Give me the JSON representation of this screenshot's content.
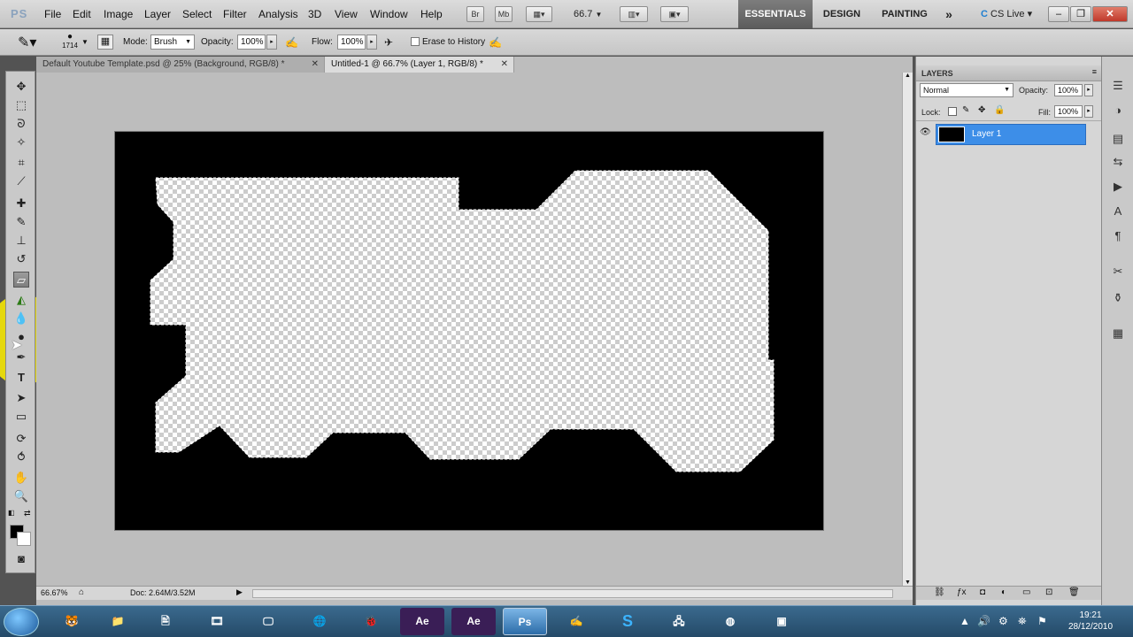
{
  "app": {
    "logo": "PS"
  },
  "menu": [
    "File",
    "Edit",
    "Image",
    "Layer",
    "Select",
    "Filter",
    "Analysis",
    "3D",
    "View",
    "Window",
    "Help"
  ],
  "appbar": {
    "bridge": "Br",
    "minibridge": "Mb",
    "zoom": "66.7",
    "zoom_arrow": "▼"
  },
  "workspaces": {
    "essentials": "ESSENTIALS",
    "design": "DESIGN",
    "painting": "PAINTING",
    "more": "»"
  },
  "cslive": "CS Live",
  "window_controls": {
    "minimize": "–",
    "restore": "❐",
    "close": "✕"
  },
  "options": {
    "brush_size": "1714",
    "mode_label": "Mode:",
    "mode_value": "Brush",
    "opacity_label": "Opacity:",
    "opacity_value": "100%",
    "flow_label": "Flow:",
    "flow_value": "100%",
    "erase_history": "Erase to History"
  },
  "tabs": [
    {
      "label": "Default Youtube Template.psd @ 25% (Background, RGB/8) *",
      "close": "✕"
    },
    {
      "label": "Untitled-1 @ 66.7% (Layer 1, RGB/8) *",
      "close": "✕"
    }
  ],
  "status": {
    "zoom": "66.67%",
    "doc": "Doc: 2.64M/3.52M"
  },
  "layers_panel": {
    "title": "LAYERS",
    "blend_mode": "Normal",
    "opacity_label": "Opacity:",
    "opacity_value": "100%",
    "lock_label": "Lock:",
    "fill_label": "Fill:",
    "fill_value": "100%",
    "layers": [
      {
        "name": "Layer 1",
        "visible": true,
        "selected": true
      }
    ]
  },
  "taskbar": {
    "apps": [
      "Ae",
      "Ae",
      "Ps",
      "S"
    ],
    "clock_time": "19:21",
    "clock_date": "28/12/2010"
  },
  "colors": {
    "accent_selected_layer": "#3d8ee8",
    "highlight": "#fff000",
    "foreground": "#000000",
    "background": "#ffffff"
  },
  "icons": [
    "move-icon",
    "marquee-icon",
    "lasso-icon",
    "quick-select-icon",
    "crop-icon",
    "eyedropper-icon",
    "healing-brush-icon",
    "brush-icon",
    "clone-stamp-icon",
    "history-brush-icon",
    "eraser-icon",
    "paint-bucket-icon",
    "blur-icon",
    "dodge-icon",
    "pen-icon",
    "type-icon",
    "path-select-icon",
    "rectangle-icon",
    "3d-rotate-icon",
    "3d-orbit-icon",
    "hand-icon",
    "zoom-icon",
    "quick-mask-icon"
  ]
}
